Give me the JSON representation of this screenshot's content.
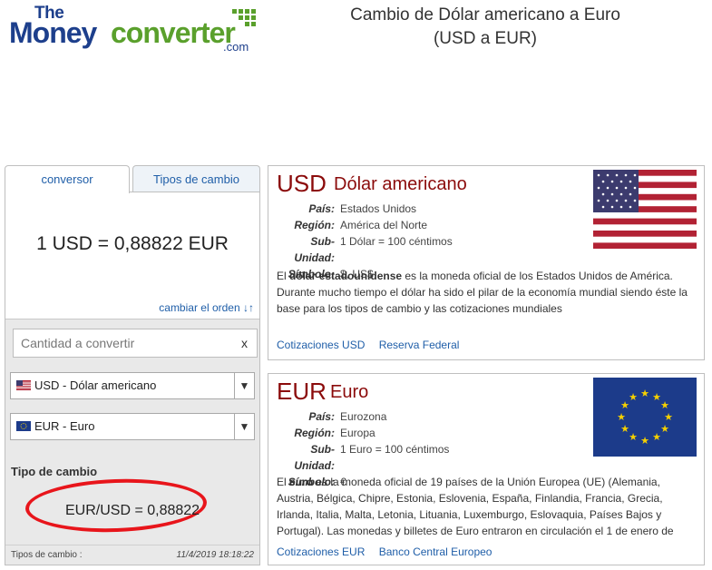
{
  "logo": {
    "the": "The",
    "money": "Money",
    "converter": "converter",
    "com": ".com"
  },
  "page_title_line1": "Cambio de Dólar americano a Euro",
  "page_title_line2": "(USD a EUR)",
  "tabs": {
    "converter": "conversor",
    "rates": "Tipos de cambio"
  },
  "converter": {
    "result": "1 USD = 0,88822 EUR",
    "swap": "cambiar el orden",
    "swap_icon": "↓↑",
    "amount_placeholder": "Cantidad a convertir",
    "clear": "x",
    "from_select": "USD - Dólar americano",
    "to_select": "EUR - Euro",
    "rate_title": "Tipo de cambio",
    "rate_value": "EUR/USD = 0,88822",
    "footer_label": "Tipos de cambio :",
    "footer_when": "11/4/2019 18:18:22",
    "dropdown_arrow": "▼"
  },
  "usd": {
    "code": "USD",
    "name": "Dólar americano",
    "labels": {
      "country": "País:",
      "region": "Región:",
      "subunit": "Sub-Unidad:",
      "symbol": "Símbolo:"
    },
    "country": "Estados Unidos",
    "region": "América del Norte",
    "subunit": "1 Dólar = 100 céntimos",
    "symbol": "$, US$",
    "desc_pre": "El ",
    "desc_bold": "dólar estadounidense",
    "desc_post": " es la moneda oficial de los Estados Unidos de América. Durante mucho tiempo el dólar ha sido el pilar de la economía mundial siendo éste la base para los tipos de cambio y las cotizaciones mundiales",
    "link1": "Cotizaciones USD",
    "link2": "Reserva Federal"
  },
  "eur": {
    "code": "EUR",
    "name": "Euro",
    "labels": {
      "country": "País:",
      "region": "Región:",
      "subunit": "Sub-Unidad:",
      "symbol": "Símbolo:"
    },
    "country": "Eurozona",
    "region": "Europa",
    "subunit": "1 Euro = 100 céntimos",
    "symbol": "€",
    "desc_pre": "El ",
    "desc_bold": "euro",
    "desc_post": " es la moneda oficial de 19 países de la Unión Europea (UE) (Alemania, Austria, Bélgica, Chipre, Estonia, Eslovenia, España, Finlandia, Francia, Grecia, Irlanda, Italia, Malta, Letonia, Lituania, Luxemburgo, Eslovaquia, Países Bajos y Portugal). Las monedas y billetes de Euro entraron en circulación el 1 de enero de",
    "link1": "Cotizaciones EUR",
    "link2": "Banco Central Europeo"
  },
  "colors": {
    "brand_blue": "#1d3f8c",
    "brand_green": "#5aa02c",
    "currency_red": "#8b0b0b",
    "link": "#1f5ea8",
    "highlight_circle": "#e8151b"
  }
}
